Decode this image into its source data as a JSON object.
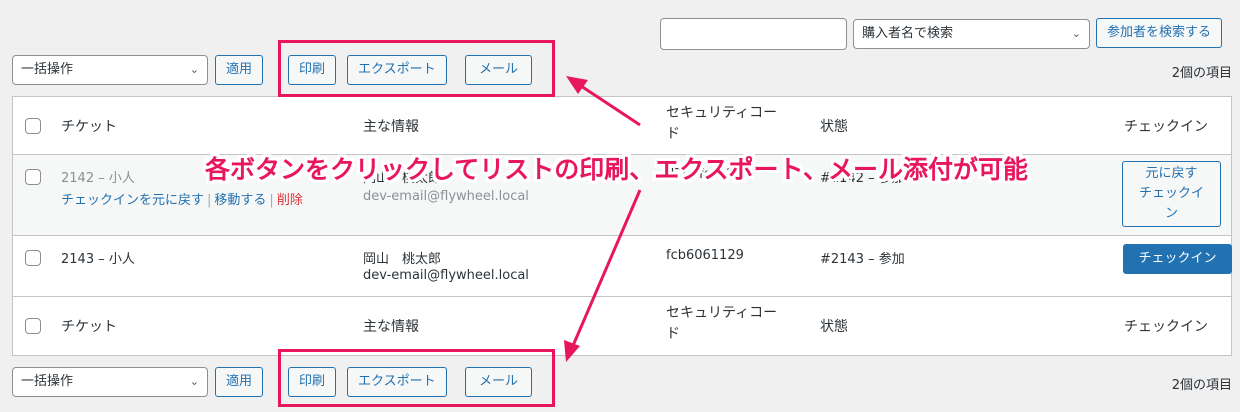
{
  "search": {
    "input_value": "",
    "select_value": "購入者名で検索",
    "button_label": "参加者を検索する"
  },
  "top_bar": {
    "bulk_select": "一括操作",
    "apply_label": "適用",
    "print_label": "印刷",
    "export_label": "エクスポート",
    "mail_label": "メール",
    "count": "2個の項目"
  },
  "bottom_bar": {
    "bulk_select": "一括操作",
    "apply_label": "適用",
    "print_label": "印刷",
    "export_label": "エクスポート",
    "mail_label": "メール",
    "count": "2個の項目"
  },
  "table": {
    "headers": {
      "ticket": "チケット",
      "info": "主な情報",
      "security_line1": "セキュリティコー",
      "security_line2": "ド",
      "status": "状態",
      "checkin": "チェックイン"
    },
    "rows": [
      {
        "ticket": "2142 – 小人",
        "info_line1": "岡山　桃太郎",
        "info_line2": "dev-email@flywheel.local",
        "security": "d7d6fc9c24",
        "status": "#2142 – 参加",
        "action_line1": "元に戻す",
        "action_line2": "チェックイ",
        "action_line3": "ン",
        "row_actions": {
          "undo": "チェックインを元に戻す",
          "move": "移動する",
          "delete": "削除"
        }
      },
      {
        "ticket": "2143 – 小人",
        "info_line1": "岡山　桃太郎",
        "info_line2": "dev-email@flywheel.local",
        "security": "fcb6061129",
        "status": "#2143 – 参加",
        "action": "チェックイン"
      }
    ]
  },
  "annotation": {
    "text": "各ボタンをクリックしてリストの印刷、エクスポート、メール添付が可能",
    "color": "#e8175d"
  }
}
